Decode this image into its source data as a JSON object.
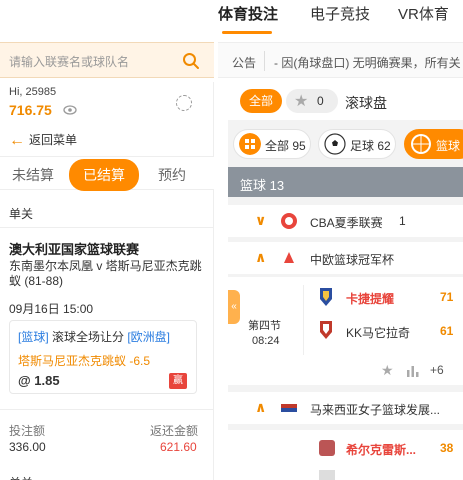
{
  "topnav": {
    "tabs": [
      {
        "label": "体育投注",
        "active": true
      },
      {
        "label": "电子竞技",
        "active": false
      },
      {
        "label": "VR体育",
        "active": false
      }
    ]
  },
  "search": {
    "placeholder": "请输入联赛名或球队名"
  },
  "notice": {
    "label": "公告",
    "text": "- 因(角球盘口) 无明确赛果，所有关"
  },
  "account": {
    "name": "Hi, 25985",
    "balance": "716.75"
  },
  "left": {
    "back_label": "返回菜单",
    "segments": [
      {
        "label": "未结算",
        "active": false
      },
      {
        "label": "已结算",
        "active": true
      },
      {
        "label": "预约",
        "active": false
      }
    ],
    "single_label": "单关",
    "bet": {
      "league": "澳大利亚国家篮球联赛",
      "teams": "东南墨尔本凤凰 v 塔斯马尼亚杰克跳蚁 (81-88)",
      "datetime": "09月16日 15:00",
      "market_prefix": "[篮球]",
      "market_name": " 滚球全场让分 ",
      "market_suffix": "[欧洲盘]",
      "selection": "塔斯马尼亚杰克跳蚁  -6.5",
      "odds": "@ 1.85",
      "result_badge": "赢"
    },
    "totals": {
      "stake_label": "投注额",
      "stake_value": "336.00",
      "return_label": "返还金额",
      "return_value": "621.60"
    },
    "single_label_2": "单关"
  },
  "right": {
    "all_pill": "全部",
    "fav_count": "0",
    "live_label": "滚球盘",
    "sports": [
      {
        "label": "全部 95",
        "active": false,
        "icon": "grid-icon"
      },
      {
        "label": "足球 62",
        "active": false,
        "icon": "soccer-ball-icon"
      },
      {
        "label": "篮球",
        "active": true,
        "icon": "basketball-icon"
      }
    ],
    "section_header": "篮球  13",
    "leagues": [
      {
        "name": "CBA夏季联赛",
        "count": "1",
        "expanded": false
      },
      {
        "name": "中欧篮球冠军杯",
        "count": "",
        "expanded": true
      },
      {
        "name": "马来西亚女子篮球发展...",
        "count": "",
        "expanded": true
      }
    ],
    "match": {
      "period": "第四节",
      "clock": "08:24",
      "home": "卡捷提耀",
      "away": "KK马它拉奇",
      "home_score": "71",
      "away_score": "61",
      "more": "+6"
    },
    "match2": {
      "home": "希尔克雷斯...",
      "home_score": "38"
    }
  },
  "colors": {
    "accent": "#ff8a00",
    "win": "#e8453c",
    "link": "#2b7de0"
  }
}
